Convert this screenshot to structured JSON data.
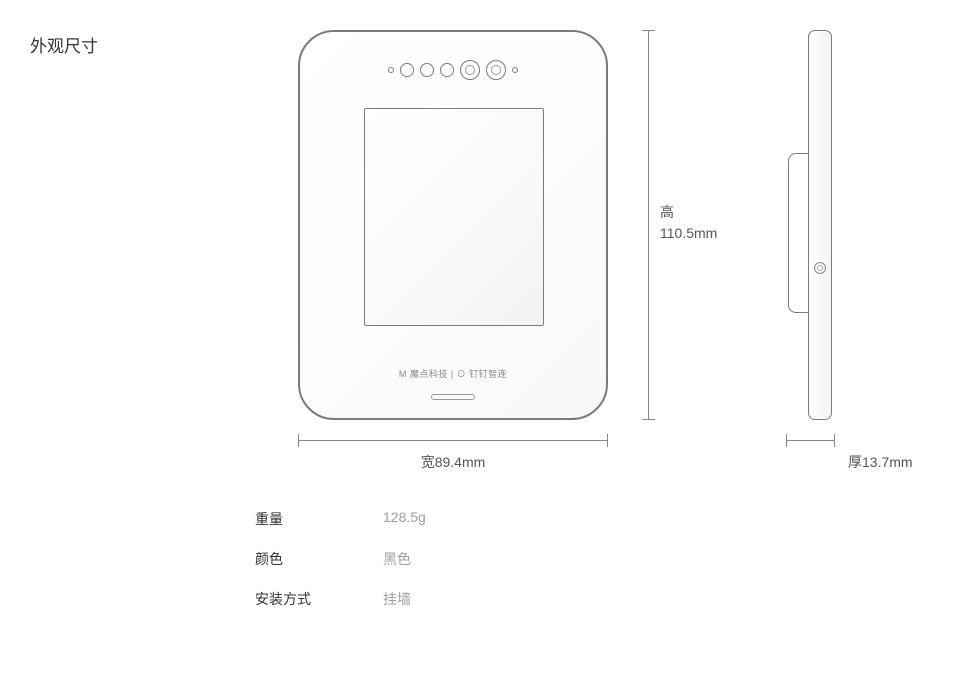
{
  "section_title": "外观尺寸",
  "dimensions": {
    "height_label": "高",
    "height_value": "110.5mm",
    "width_label": "宽",
    "width_value": "89.4mm",
    "thickness_label": "厚",
    "thickness_value": "13.7mm"
  },
  "brand_text": "M 魔点科技 | ⊙ 钉钉智连",
  "specs": [
    {
      "label": "重量",
      "value": "128.5g"
    },
    {
      "label": "颜色",
      "value": "黑色"
    },
    {
      "label": "安装方式",
      "value": "挂墙"
    }
  ]
}
